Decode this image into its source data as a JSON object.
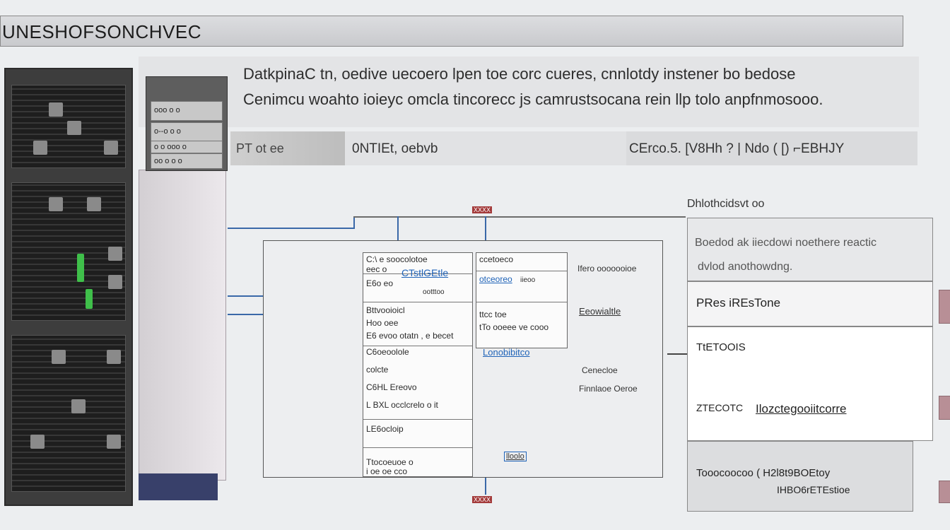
{
  "title": "UNESHOFSONCHVEC",
  "description": {
    "line1": "DatkpinaC tn, oedive uecoero lpen toe corc cueres, cnnlotdy instener bo bedose",
    "line2": "Cenimcu woahto ioieyc omcla tincorecc js camrustsocana rein llp tolo anpfnmosooo."
  },
  "info_bar": {
    "seg_label": "PT  ot   ee",
    "left_label": "0NTIEt, oebvb",
    "right_label": "CErco.5.  [V8Hh  ? | Ndo ( [) ⌐EBHJY"
  },
  "switch_units": [
    "ooo  o o",
    "o--o  o  o",
    "o  o ooo o",
    "oo  o o o"
  ],
  "diagram": {
    "top_tag": "XXXX",
    "bottom_tag": "XXXX",
    "col1": [
      {
        "lines": [
          "C:\\ e soocolotoe",
          "eec o"
        ],
        "link": "CTstlGEtle"
      },
      {
        "lines": [
          "E6o eo",
          "",
          "ootttoo"
        ]
      },
      {
        "lines": [
          "Bttvooioicl",
          "Hoo oee",
          "E6 evoo  otatn , e  becet"
        ]
      },
      {
        "lines": [
          "C6oeoolole",
          "",
          "colcte",
          "",
          "C6HL Ereovo",
          "",
          "L BXL occlcrelo o it"
        ]
      },
      {
        "lines": [
          "LE6ocloip"
        ]
      },
      {
        "lines": [
          "Ttocoeuoe o",
          "i oe oe cco"
        ]
      }
    ],
    "col2": [
      {
        "lines": [
          "ccetoeco",
          ""
        ],
        "link": "otceoreo",
        "extra": "iieoo"
      },
      {
        "lines": [
          "ttcc toe ",
          "tTo ooeee  ve  cooo"
        ]
      },
      {
        "link": "Lonobibitco"
      }
    ],
    "ann_right1": "Ifero ooooooioe",
    "ann_right2": "Eeowialtle",
    "ann_right3": "Cenecloe",
    "ann_right4": "Finnlaoe Oeroe",
    "bottom_link": "lloolo"
  },
  "right_panel": {
    "heading": "Dhlothcidsvt oo",
    "box1_line1": "Boedod ak iiecdowi noethere reactic",
    "box1_line2": "dvlod anothowdng.",
    "box2": "PRes  iREsTone",
    "box3_title": "TtETOOIS",
    "box3_label": "ZTECOTC",
    "box3_link": "Ilozctegooiitcorre",
    "box4_line1": "Tooocoocoo  (  H2l8t9BOEtoy",
    "box4_line2": "IHBO6rETEstioe"
  },
  "colors": {
    "accent": "#1f63b8",
    "rack": "#2b2b2b",
    "led_green": "#3fbf4a"
  }
}
